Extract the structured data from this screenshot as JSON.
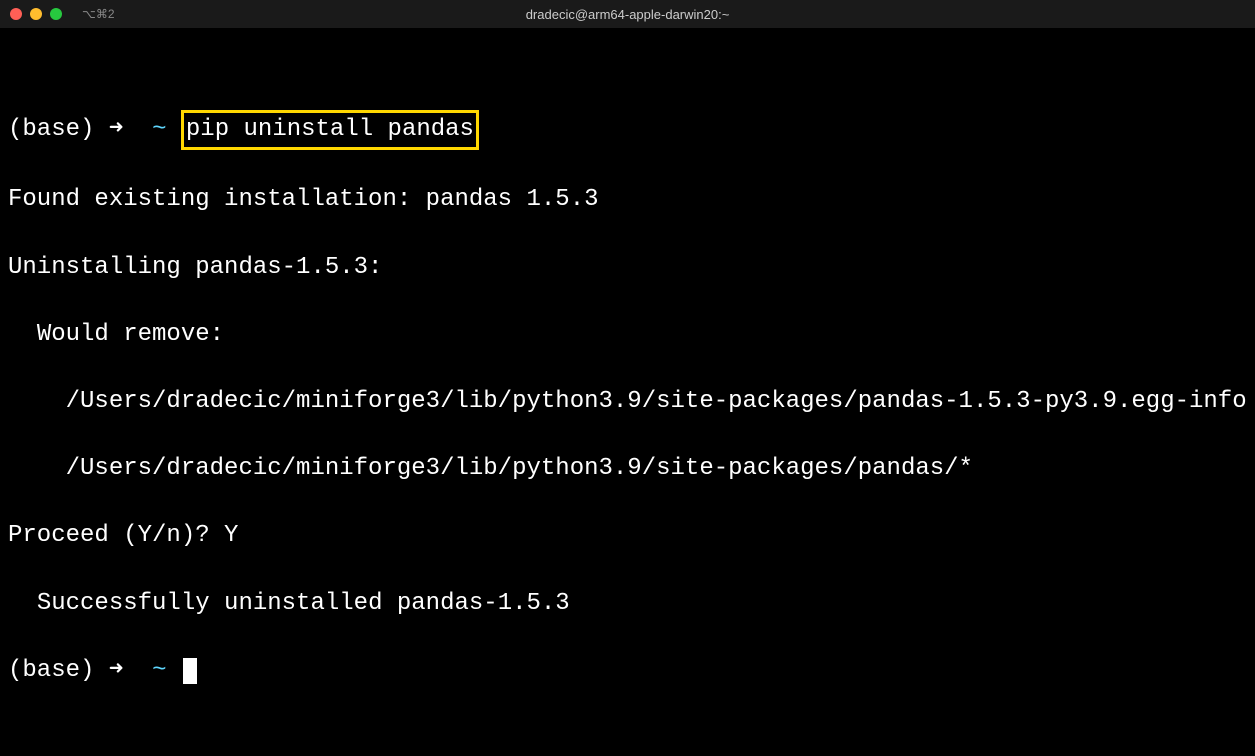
{
  "titlebar": {
    "tab_label": "⌥⌘2",
    "window_title": "dradecic@arm64-apple-darwin20:~"
  },
  "terminal": {
    "prompt1": {
      "base": "(base)",
      "arrow": "➜",
      "tilde": "~",
      "command": "pip uninstall pandas"
    },
    "output": {
      "line1": "Found existing installation: pandas 1.5.3",
      "line2": "Uninstalling pandas-1.5.3:",
      "line3": "  Would remove:",
      "line4": "    /Users/dradecic/miniforge3/lib/python3.9/site-packages/pandas-1.5.3-py3.9.egg-info",
      "line5": "    /Users/dradecic/miniforge3/lib/python3.9/site-packages/pandas/*",
      "line6": "Proceed (Y/n)? Y",
      "line7": "  Successfully uninstalled pandas-1.5.3"
    },
    "prompt2": {
      "base": "(base)",
      "arrow": "➜",
      "tilde": "~"
    }
  }
}
